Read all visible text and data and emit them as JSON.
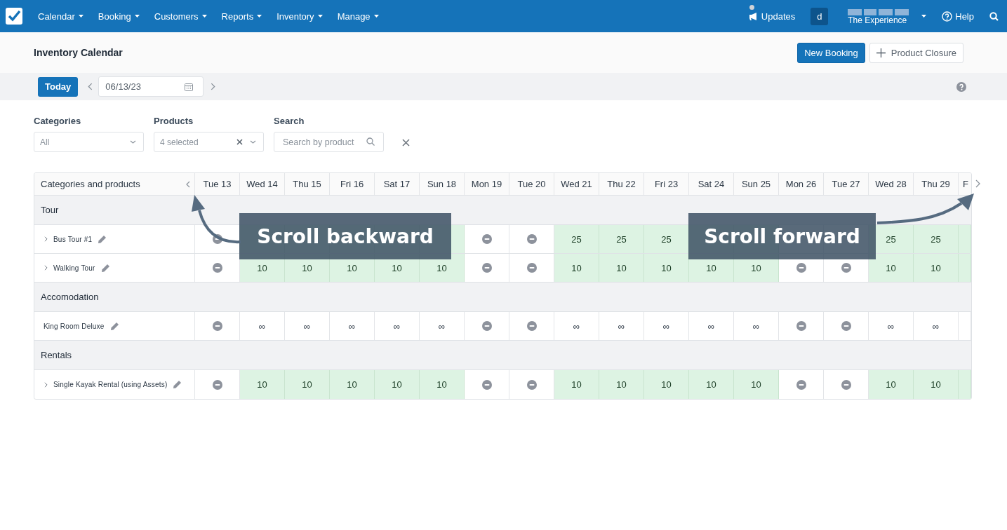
{
  "nav": {
    "menus": [
      {
        "label": "Calendar"
      },
      {
        "label": "Booking"
      },
      {
        "label": "Customers"
      },
      {
        "label": "Reports"
      },
      {
        "label": "Inventory"
      },
      {
        "label": "Manage"
      }
    ],
    "updates": "Updates",
    "user_initial": "d",
    "company": "The Experience",
    "help": "Help"
  },
  "page_title": "Inventory Calendar",
  "actions": {
    "primary": "New Booking",
    "secondary": "Product Closure"
  },
  "toolbar": {
    "today": "Today",
    "date": "06/13/23"
  },
  "filters": [
    {
      "kind": "select",
      "label": "Categories",
      "value": "All",
      "clearable": false
    },
    {
      "kind": "select",
      "label": "Products",
      "value": "4 selected",
      "clearable": true
    },
    {
      "kind": "search",
      "label": "Search",
      "placeholder": "Search by product"
    }
  ],
  "table": {
    "corner": "Categories and products",
    "columns": [
      "Tue 13",
      "Wed 14",
      "Thu 15",
      "Fri 16",
      "Sat 17",
      "Sun 18",
      "Mon 19",
      "Tue 20",
      "Wed 21",
      "Thu 22",
      "Fri 23",
      "Sat 24",
      "Sun 25",
      "Mon 26",
      "Tue 27",
      "Wed 28",
      "Thu 29",
      "F"
    ],
    "groups": [
      {
        "name": "Tour",
        "products": [
          {
            "name": "Bus Tour #1",
            "expandable": true,
            "cells": [
              {
                "kind": "closed"
              },
              {
                "kind": "open"
              },
              {
                "kind": "open"
              },
              {
                "kind": "open"
              },
              {
                "kind": "open"
              },
              {
                "kind": "open"
              },
              {
                "kind": "closed"
              },
              {
                "kind": "closed"
              },
              {
                "kind": "open",
                "value": "25"
              },
              {
                "kind": "open",
                "value": "25"
              },
              {
                "kind": "open",
                "value": "25"
              },
              {
                "kind": "open"
              },
              {
                "kind": "open"
              },
              {
                "kind": "blank"
              },
              {
                "kind": "blank"
              },
              {
                "kind": "open",
                "value": "25"
              },
              {
                "kind": "open",
                "value": "25"
              },
              {
                "kind": "open"
              }
            ]
          },
          {
            "name": "Walking Tour",
            "expandable": true,
            "cells": [
              {
                "kind": "closed"
              },
              {
                "kind": "open",
                "value": "10"
              },
              {
                "kind": "open",
                "value": "10"
              },
              {
                "kind": "open",
                "value": "10"
              },
              {
                "kind": "open",
                "value": "10"
              },
              {
                "kind": "open",
                "value": "10"
              },
              {
                "kind": "closed"
              },
              {
                "kind": "closed"
              },
              {
                "kind": "open",
                "value": "10"
              },
              {
                "kind": "open",
                "value": "10"
              },
              {
                "kind": "open",
                "value": "10"
              },
              {
                "kind": "open",
                "value": "10"
              },
              {
                "kind": "open",
                "value": "10"
              },
              {
                "kind": "closed"
              },
              {
                "kind": "closed"
              },
              {
                "kind": "open",
                "value": "10"
              },
              {
                "kind": "open",
                "value": "10"
              },
              {
                "kind": "open"
              }
            ]
          }
        ]
      },
      {
        "name": "Accomodation",
        "products": [
          {
            "name": "King Room Deluxe",
            "expandable": false,
            "cells": [
              {
                "kind": "closed"
              },
              {
                "kind": "unlimited",
                "value": "∞"
              },
              {
                "kind": "unlimited",
                "value": "∞"
              },
              {
                "kind": "unlimited",
                "value": "∞"
              },
              {
                "kind": "unlimited",
                "value": "∞"
              },
              {
                "kind": "unlimited",
                "value": "∞"
              },
              {
                "kind": "closed"
              },
              {
                "kind": "closed"
              },
              {
                "kind": "unlimited",
                "value": "∞"
              },
              {
                "kind": "unlimited",
                "value": "∞"
              },
              {
                "kind": "unlimited",
                "value": "∞"
              },
              {
                "kind": "unlimited",
                "value": "∞"
              },
              {
                "kind": "unlimited",
                "value": "∞"
              },
              {
                "kind": "closed"
              },
              {
                "kind": "closed"
              },
              {
                "kind": "unlimited",
                "value": "∞"
              },
              {
                "kind": "unlimited",
                "value": "∞"
              },
              {
                "kind": "blank"
              }
            ]
          }
        ]
      },
      {
        "name": "Rentals",
        "products": [
          {
            "name": "Single Kayak Rental (using Assets)",
            "expandable": true,
            "cells": [
              {
                "kind": "closed"
              },
              {
                "kind": "open",
                "value": "10"
              },
              {
                "kind": "open",
                "value": "10"
              },
              {
                "kind": "open",
                "value": "10"
              },
              {
                "kind": "open",
                "value": "10"
              },
              {
                "kind": "open",
                "value": "10"
              },
              {
                "kind": "closed"
              },
              {
                "kind": "closed"
              },
              {
                "kind": "open",
                "value": "10"
              },
              {
                "kind": "open",
                "value": "10"
              },
              {
                "kind": "open",
                "value": "10"
              },
              {
                "kind": "open",
                "value": "10"
              },
              {
                "kind": "open",
                "value": "10"
              },
              {
                "kind": "closed"
              },
              {
                "kind": "closed"
              },
              {
                "kind": "open",
                "value": "10"
              },
              {
                "kind": "open",
                "value": "10"
              },
              {
                "kind": "open"
              }
            ]
          }
        ]
      }
    ]
  },
  "annotations": [
    {
      "text": "Scroll backward"
    },
    {
      "text": "Scroll forward"
    }
  ]
}
